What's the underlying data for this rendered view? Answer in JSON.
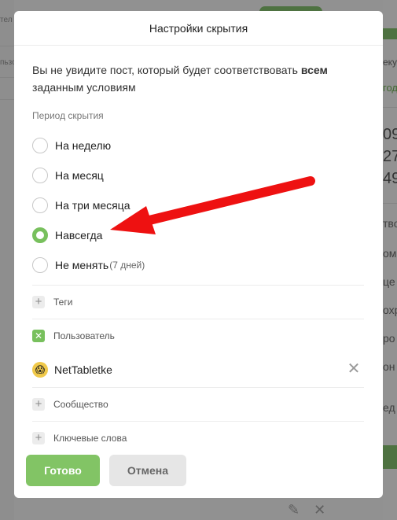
{
  "background": {
    "left_fragments": [
      "тел",
      "пьзов"
    ],
    "right_fragments": [
      "еку",
      "год",
      "09",
      "27",
      "49",
      "тво",
      "ом",
      "це",
      "охр",
      "ро",
      "он",
      "ед"
    ],
    "bottom_icons": [
      "pencil-icon",
      "close-icon"
    ]
  },
  "modal": {
    "title": "Настройки скрытия",
    "description_start": "Вы не увидите пост, который будет соответствовать ",
    "description_bold": "всем",
    "description_end": " заданным условиям",
    "period_label": "Период скрытия",
    "period_options": [
      {
        "label": "На неделю",
        "sub": "",
        "checked": false
      },
      {
        "label": "На месяц",
        "sub": "",
        "checked": false
      },
      {
        "label": "На три месяца",
        "sub": "",
        "checked": false
      },
      {
        "label": "Навсегда",
        "sub": "",
        "checked": true
      },
      {
        "label": "Не менять",
        "sub": "(7 дней)",
        "checked": false
      }
    ],
    "filters": {
      "tags": {
        "label": "Теги",
        "icon": "plus-icon"
      },
      "user": {
        "label": "Пользователь",
        "icon": "check-icon",
        "value": "NetTabletke"
      },
      "community": {
        "label": "Сообщество",
        "icon": "plus-icon"
      },
      "keywords": {
        "label": "Ключевые слова",
        "icon": "plus-icon"
      }
    },
    "buttons": {
      "done": "Готово",
      "cancel": "Отмена"
    }
  },
  "colors": {
    "accent_green": "#78c05d",
    "button_green": "#82c465",
    "annotation_red": "#ee1111"
  }
}
